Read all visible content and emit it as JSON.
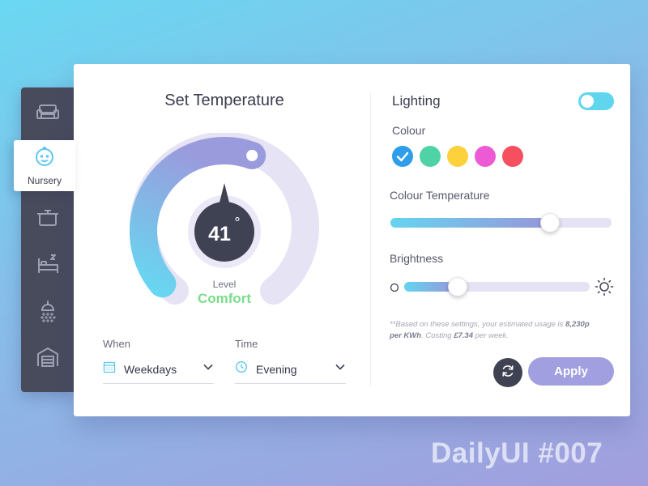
{
  "sidebar": {
    "items": [
      {
        "icon": "sofa-icon"
      },
      {
        "icon": "baby-face-icon",
        "label": "Nursery",
        "active": true
      },
      {
        "icon": "pot-icon"
      },
      {
        "icon": "bed-icon"
      },
      {
        "icon": "shower-icon"
      },
      {
        "icon": "garage-icon"
      }
    ]
  },
  "temperature": {
    "title": "Set Temperature",
    "value": "41",
    "unit": "°",
    "level_label": "Level",
    "level_value": "Comfort"
  },
  "schedule": {
    "when_label": "When",
    "when_value": "Weekdays",
    "time_label": "Time",
    "time_value": "Evening"
  },
  "lighting": {
    "title": "Lighting",
    "enabled": true,
    "colour_label": "Colour",
    "colours": [
      "#2f9de9",
      "#4fd2a6",
      "#fcd13c",
      "#ec5bd3",
      "#f64f60"
    ],
    "selected_colour_index": 0,
    "colour_temperature_label": "Colour Temperature",
    "colour_temperature_level": 0.72,
    "brightness_label": "Brightness",
    "brightness_level": 0.29
  },
  "note": {
    "prefix": "**Based on these settings, your estimated usage is ",
    "usage": "8,230p per KWh",
    "middle": ". Costing ",
    "cost": "£7.34",
    "suffix": " per week."
  },
  "actions": {
    "apply_label": "Apply"
  },
  "watermark": "DailyUI #007",
  "colors": {
    "accent": "#a29fe0",
    "toggle_on": "#5fd6ee",
    "comfort": "#7bdc8c",
    "dark": "#3f4252"
  }
}
